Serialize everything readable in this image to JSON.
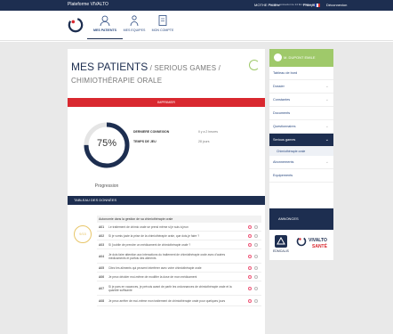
{
  "topbar": {
    "brand": "Plateforme VIVALTO",
    "user": "MOTHE Pauline",
    "last_connection": "dernière connexion le 14 fév 2018 à 15:03",
    "lang": "Français",
    "logout": "Déconnexion"
  },
  "nav": {
    "items": [
      {
        "label": "MES PATIENTS",
        "icon": "patients-icon"
      },
      {
        "label": "MES EQUIPES",
        "icon": "team-icon"
      },
      {
        "label": "MON COMPTE",
        "icon": "account-icon"
      }
    ]
  },
  "page": {
    "title": "MES PATIENTS",
    "breadcrumb_sub": " / SERIOUS GAMES / CHIMIOTHÉRAPIE ORALE",
    "print_label": "IMPRIMER",
    "progress_pct": "75%",
    "progress_value": 0.75,
    "progress_label": "Progression",
    "info": [
      {
        "key": "DERNIERE CONNEXION",
        "value": "Il y a 2 heures"
      },
      {
        "key": "TEMPS DE JEU",
        "value": "28 jours"
      }
    ],
    "table_title": "TABLEAU DES DONNÉES",
    "objective_badge": "9/15",
    "rows_header": "Autonomie dans la gestion de sa chimiothérapie orale",
    "rows": [
      {
        "code": "A01",
        "text": "Le traitement de chimio orale se prend même si je suis à jeun"
      },
      {
        "code": "A02",
        "text": "Si je vomis juste la prise de la chimiothérapie orale, que dois-je faire ?"
      },
      {
        "code": "A03",
        "text": "Si j'oublie de prendre un médicament de chimiothérapie orale ?"
      },
      {
        "code": "A04",
        "text": "Je dois faire attention aux interactions du traitement de chimiothérapie orale avec d'autres médicaments et parfois des aliments"
      },
      {
        "code": "A05",
        "text": "Citez les aliments qui peuvent interférer avec votre chimiothérapie orale"
      },
      {
        "code": "A06",
        "text": "Je peux décider moi-même de modifier la dose de mon médicament"
      },
      {
        "code": "A07",
        "text": "Si je pars en vacances, je prévois avant de partir les ordonnances de chimiothérapie orale et la quantité suffisante"
      },
      {
        "code": "A08",
        "text": "Je peux arrêter de moi-même mon traitement de chimiothérapie orale pour quelques jours"
      }
    ]
  },
  "sidebar": {
    "patient_name": "M. DUPONT EMILE",
    "items": [
      {
        "label": "Tableau de bord",
        "chev": ""
      },
      {
        "label": "Dossier",
        "chev": "⌄"
      },
      {
        "label": "Constantes",
        "chev": "⌄"
      },
      {
        "label": "Documents",
        "chev": ""
      },
      {
        "label": "Questionnaires",
        "chev": "⌄"
      },
      {
        "label": "Serious games",
        "chev": "⌄"
      },
      {
        "label": "Abonnements",
        "chev": "⌄"
      },
      {
        "label": "Equipements",
        "chev": ""
      }
    ],
    "sub_item": "Chimiothérapie orale",
    "annonces": "ANNONCES",
    "sponsor_left": "EDMCALIS",
    "sponsor_right_a": "VIVALTO",
    "sponsor_right_b": "SANTÉ"
  },
  "colors": {
    "navy": "#1d2e50",
    "red": "#d9282f",
    "green": "#9fc96a",
    "gold": "#e8c66a"
  }
}
